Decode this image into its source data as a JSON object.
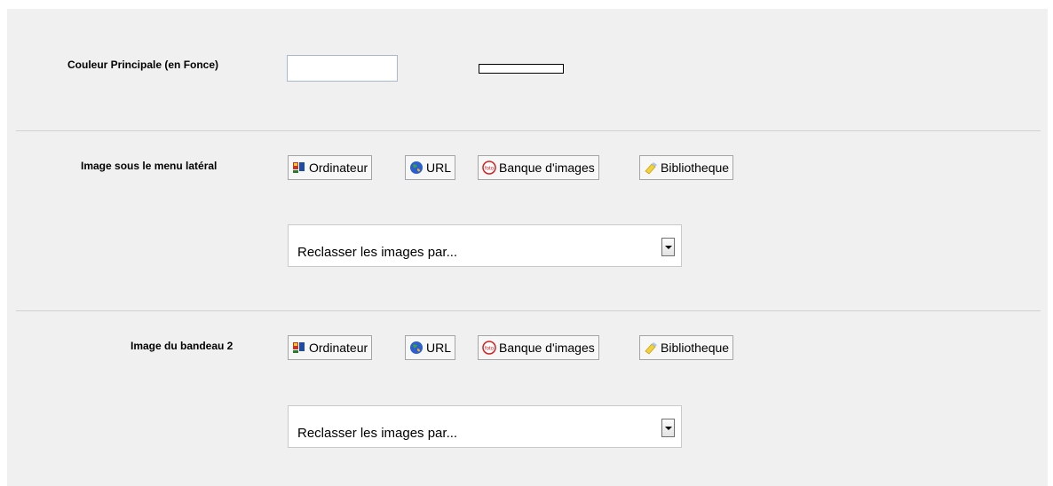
{
  "rows": [
    {
      "label": "Couleur Principale (en Fonce)",
      "color_value": ""
    },
    {
      "label": "Image sous le menu latéral",
      "buttons": [
        "Ordinateur",
        "URL",
        "Banque d'images",
        "Bibliotheque"
      ],
      "sort_select": "Reclasser les images par..."
    },
    {
      "label": "Image du bandeau 2",
      "buttons": [
        "Ordinateur",
        "URL",
        "Banque d'images",
        "Bibliotheque"
      ],
      "sort_select": "Reclasser les images par..."
    }
  ],
  "icons": [
    "computer-icon",
    "globe-icon",
    "foto-icon",
    "library-icon"
  ]
}
